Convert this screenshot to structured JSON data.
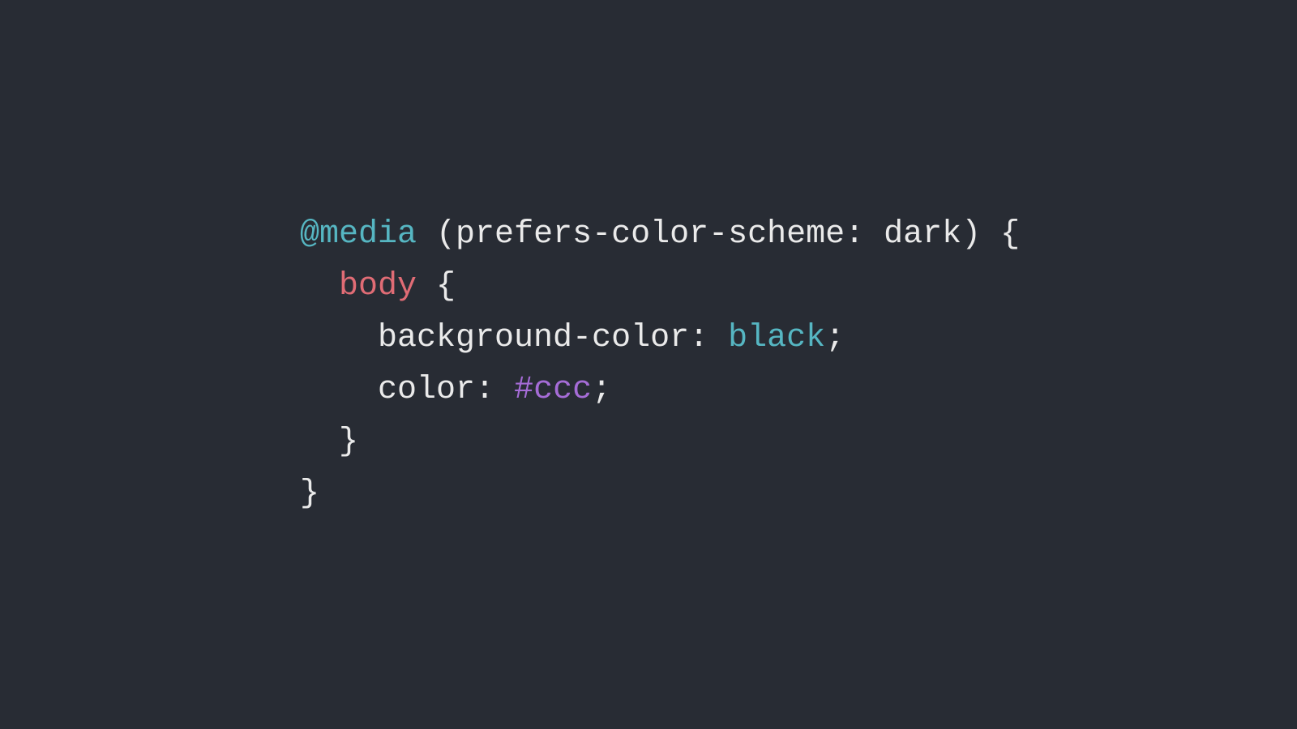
{
  "code": {
    "atrule": "@media",
    "condition": "(prefers-color-scheme: dark)",
    "open_brace": "{",
    "selector": "body",
    "selector_open": "{",
    "prop1": "background-color",
    "colon": ":",
    "val1": "black",
    "semi": ";",
    "prop2": "color",
    "val2": "#ccc",
    "selector_close": "}",
    "close_brace": "}"
  }
}
